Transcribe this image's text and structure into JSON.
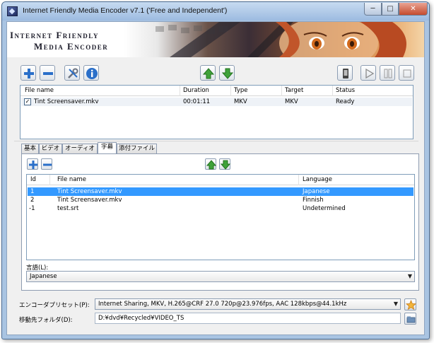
{
  "window": {
    "title": "Internet Friendly Media Encoder v7.1 ('Free and Independent')",
    "min_glyph": "─",
    "max_glyph": "□",
    "close_glyph": "✕"
  },
  "banner": {
    "line1": "Internet Friendly",
    "line2": "Media Encoder"
  },
  "toolbar": {
    "icons": [
      "add-icon",
      "remove-icon",
      "tools-icon",
      "info-icon",
      "move-up-icon",
      "move-down-icon",
      "device-icon",
      "play-icon",
      "pause-icon",
      "stop-icon"
    ]
  },
  "queue": {
    "columns": [
      "File name",
      "Duration",
      "Type",
      "Target",
      "Status"
    ],
    "rows": [
      {
        "checked": "✓",
        "file": "Tint Screensaver.mkv",
        "duration": "00:01:11",
        "type": "MKV",
        "target": "MKV",
        "status": "Ready"
      }
    ]
  },
  "tabs": [
    "基本",
    "ビデオ",
    "オーディオ",
    "字幕",
    "添付ファイル"
  ],
  "active_tab": "字幕",
  "subtitles": {
    "columns": [
      "Id",
      "File name",
      "Language"
    ],
    "rows": [
      {
        "id": "1",
        "file": "Tint Screensaver.mkv",
        "language": "Japanese",
        "selected": true
      },
      {
        "id": "2",
        "file": "Tint Screensaver.mkv",
        "language": "Finnish",
        "selected": false
      },
      {
        "id": "-1",
        "file": "test.srt",
        "language": "Undetermined",
        "selected": false
      }
    ],
    "language_label": "言語(L):",
    "language_value": "Japanese"
  },
  "footer": {
    "preset_label": "エンコーダプリセット(P):",
    "preset_value": "Internet Sharing, MKV, H.265@CRF 27.0 720p@23.976fps, AAC 128kbps@44.1kHz",
    "folder_label": "移動先フォルダ(D):",
    "folder_value": "D:¥dvd¥Recycled¥VIDEO_TS"
  },
  "colors": {
    "selection": "#3399ff",
    "window_frame": "#a9c4e2",
    "green_arrow": "#3fa23a",
    "blue_icon": "#2a6fc9"
  }
}
